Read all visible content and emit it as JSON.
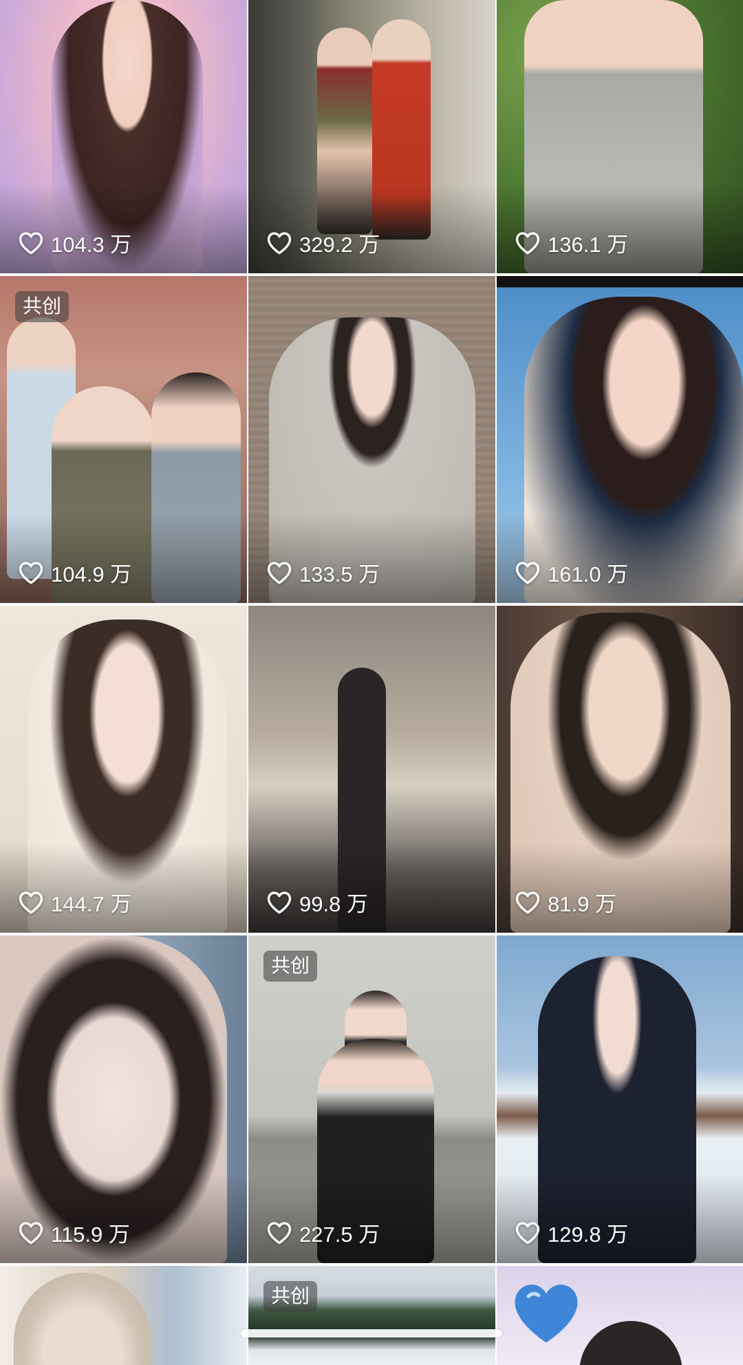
{
  "feed": {
    "tiles": [
      {
        "likes": "104.3 万",
        "badge": "",
        "colors": [
          "#e9b7c9",
          "#c9a8dc",
          "#f3d5cf"
        ]
      },
      {
        "likes": "329.2 万",
        "badge": "",
        "colors": [
          "#6f6a5c",
          "#bfa995",
          "#3e3a33"
        ]
      },
      {
        "likes": "136.1 万",
        "badge": "",
        "colors": [
          "#4f7a33",
          "#a8aaa3",
          "#2f4c20"
        ]
      },
      {
        "likes": "104.9 万",
        "badge": "共创",
        "colors": [
          "#b5786a",
          "#d9c6b5",
          "#7a5a4e"
        ]
      },
      {
        "likes": "133.5 万",
        "badge": "",
        "colors": [
          "#9b8a7c",
          "#c8c4bd",
          "#5c4f44"
        ]
      },
      {
        "likes": "161.0 万",
        "badge": "",
        "colors": [
          "#6fa7d6",
          "#efe6dd",
          "#1d2c44"
        ]
      },
      {
        "likes": "144.7 万",
        "badge": "",
        "colors": [
          "#e7ddd1",
          "#f2e9df",
          "#3c2c26"
        ]
      },
      {
        "likes": "99.8 万",
        "badge": "",
        "colors": [
          "#a79f96",
          "#d6cfc2",
          "#3b3635"
        ]
      },
      {
        "likes": "81.9 万",
        "badge": "",
        "colors": [
          "#6b5548",
          "#e5cfc0",
          "#2b211c"
        ]
      },
      {
        "likes": "115.9 万",
        "badge": "",
        "colors": [
          "#8da2b7",
          "#ead9d3",
          "#2a2020"
        ]
      },
      {
        "likes": "227.5 万",
        "badge": "共创",
        "colors": [
          "#c3c3c0",
          "#8d8c88",
          "#1f2022"
        ]
      },
      {
        "likes": "129.8 万",
        "badge": "",
        "colors": [
          "#7fa8cf",
          "#e4ecf2",
          "#1d2230"
        ]
      },
      {
        "likes": "",
        "badge": "",
        "colors": [
          "#d9cdbf",
          "#f2ede6",
          "#5a4f47"
        ]
      },
      {
        "likes": "",
        "badge": "共创",
        "colors": [
          "#3e5840",
          "#d6dce2",
          "#1f2f22"
        ]
      },
      {
        "likes": "",
        "badge": "",
        "colors": [
          "#dbd3ea",
          "#efeaf6",
          "#3f86d9"
        ]
      }
    ]
  }
}
